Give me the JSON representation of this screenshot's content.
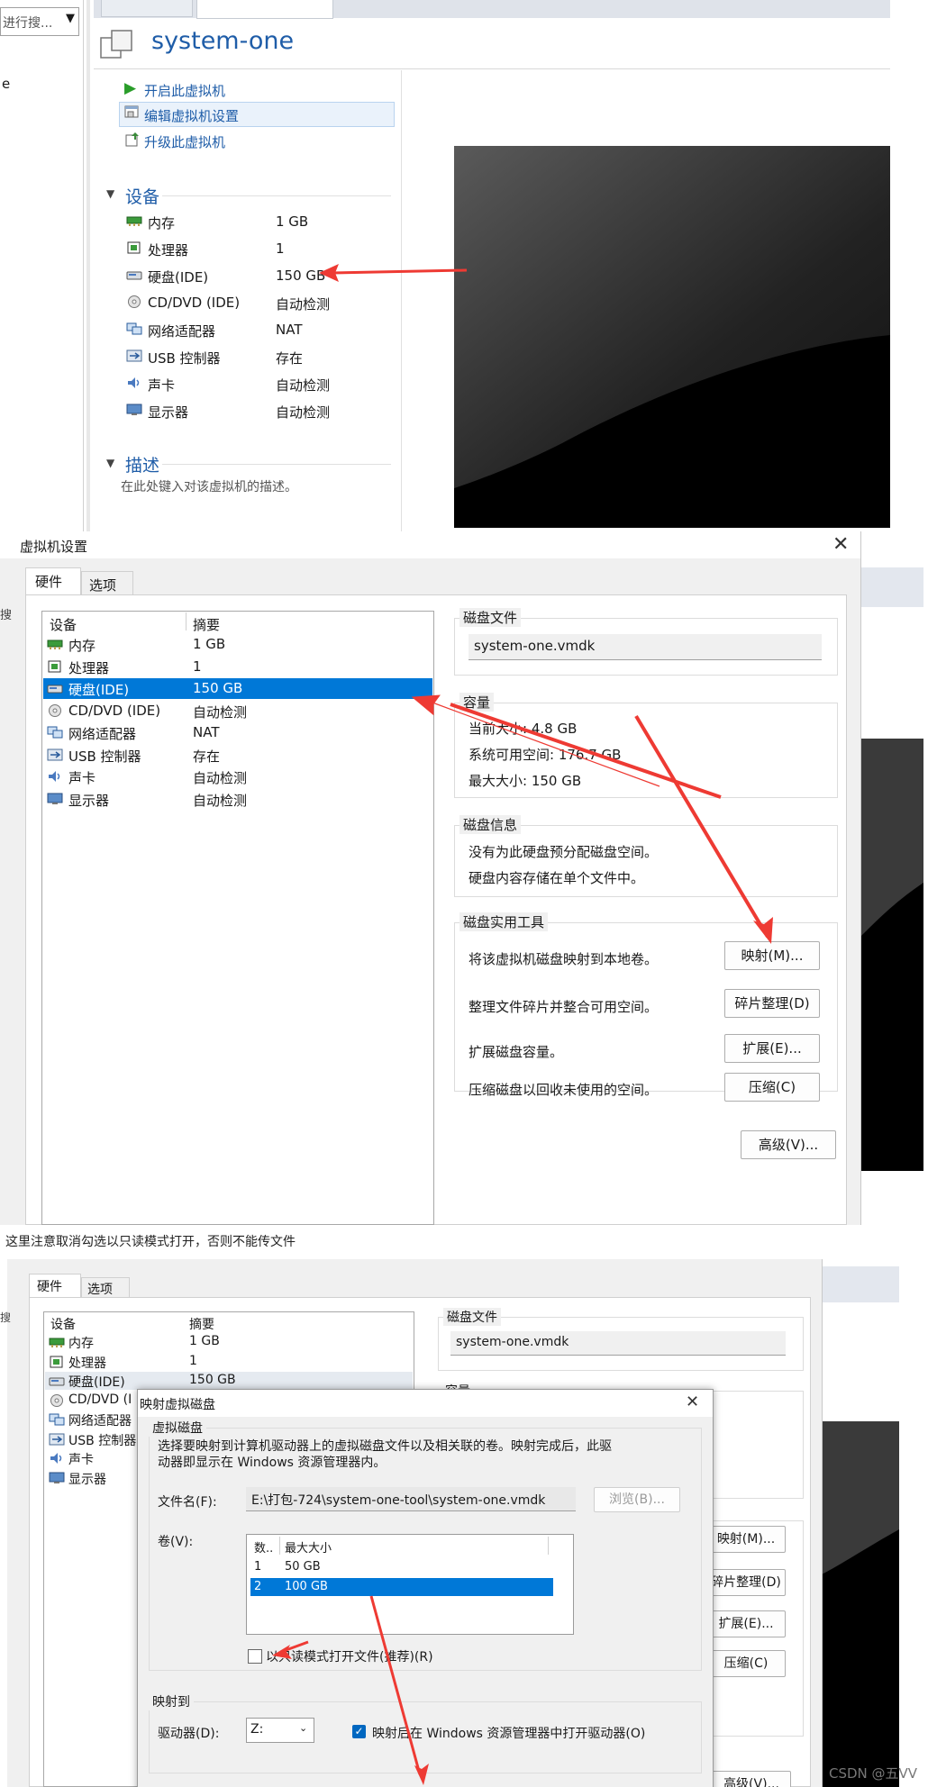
{
  "vm_page": {
    "search_placeholder": "进行搜...",
    "tab_partial": "e",
    "title": "system-one",
    "actions": [
      "开启此虚拟机",
      "编辑虚拟机设置",
      "升级此虚拟机"
    ],
    "devices_header": "设备",
    "devices": [
      {
        "name": "内存",
        "value": "1 GB"
      },
      {
        "name": "处理器",
        "value": "1"
      },
      {
        "name": "硬盘(IDE)",
        "value": "150 GB"
      },
      {
        "name": "CD/DVD (IDE)",
        "value": "自动检测"
      },
      {
        "name": "网络适配器",
        "value": "NAT"
      },
      {
        "name": "USB 控制器",
        "value": "存在"
      },
      {
        "name": "声卡",
        "value": "自动检测"
      },
      {
        "name": "显示器",
        "value": "自动检测"
      }
    ],
    "desc_header": "描述",
    "desc_text": "在此处键入对该虚拟机的描述。"
  },
  "settings": {
    "title": "虚拟机设置",
    "tabs": [
      "硬件",
      "选项"
    ],
    "left_partial": "搜",
    "col_device": "设备",
    "col_summary": "摘要",
    "devices": [
      {
        "name": "内存",
        "value": "1 GB"
      },
      {
        "name": "处理器",
        "value": "1"
      },
      {
        "name": "硬盘(IDE)",
        "value": "150 GB"
      },
      {
        "name": "CD/DVD (IDE)",
        "value": "自动检测"
      },
      {
        "name": "网络适配器",
        "value": "NAT"
      },
      {
        "name": "USB 控制器",
        "value": "存在"
      },
      {
        "name": "声卡",
        "value": "自动检测"
      },
      {
        "name": "显示器",
        "value": "自动检测"
      }
    ],
    "disk_file_title": "磁盘文件",
    "disk_file": "system-one.vmdk",
    "capacity_title": "容量",
    "current_size": "当前大小: 4.8 GB",
    "free_space": "系统可用空间: 176.7 GB",
    "max_size": "最大大小: 150 GB",
    "disk_info_title": "磁盘信息",
    "disk_info_1": "没有为此硬盘预分配磁盘空间。",
    "disk_info_2": "硬盘内容存储在单个文件中。",
    "tools_title": "磁盘实用工具",
    "tool_map_text": "将该虚拟机磁盘映射到本地卷。",
    "tool_map_btn": "映射(M)...",
    "tool_defrag_text": "整理文件碎片并整合可用空间。",
    "tool_defrag_btn": "碎片整理(D)",
    "tool_expand_text": "扩展磁盘容量。",
    "tool_expand_btn": "扩展(E)...",
    "tool_compact_text": "压缩磁盘以回收未使用的空间。",
    "tool_compact_btn": "压缩(C)",
    "advanced_btn": "高级(V)..."
  },
  "note": "这里注意取消勾选以只读模式打开，否则不能传文件",
  "third": {
    "tabs": [
      "硬件",
      "选项"
    ],
    "left_partial": "搜",
    "col_device": "设备",
    "col_summary": "摘要",
    "devices": [
      {
        "name": "内存",
        "value": "1 GB"
      },
      {
        "name": "处理器",
        "value": "1"
      },
      {
        "name": "硬盘(IDE)",
        "value": "150 GB"
      },
      {
        "name": "CD/DVD (I",
        "value": ""
      },
      {
        "name": "网络适配器",
        "value": ""
      },
      {
        "name": "USB 控制器",
        "value": ""
      },
      {
        "name": "声卡",
        "value": ""
      },
      {
        "name": "显示器",
        "value": ""
      }
    ],
    "disk_file_title": "磁盘文件",
    "disk_file": "system-one.vmdk",
    "capacity_partial": "容量",
    "map_btn": "映射(M)...",
    "defrag_btn": "碎片整理(D)",
    "expand_btn": "扩展(E)...",
    "compact_btn": "压缩(C)",
    "advanced_btn": "高级(V)..."
  },
  "map_dialog": {
    "title": "映射虚拟磁盘",
    "group_title": "虚拟磁盘",
    "desc_line1": "选择要映射到计算机驱动器上的虚拟磁盘文件以及相关联的卷。映射完成后，此驱",
    "desc_line2": "动器即显示在 Windows 资源管理器内。",
    "filename_label": "文件名(F):",
    "filename_value": "E:\\打包-724\\system-one-tool\\system-one.vmdk",
    "browse_btn": "浏览(B)...",
    "volume_label": "卷(V):",
    "vol_col_num": "数..",
    "vol_col_size": "最大大小",
    "volumes": [
      {
        "num": "1",
        "size": "50 GB",
        "selected": false
      },
      {
        "num": "2",
        "size": "100 GB",
        "selected": true
      }
    ],
    "readonly_label": "以只读模式打开文件(推荐)(R)",
    "readonly_checked": false,
    "map_to_title": "映射到",
    "drive_label": "驱动器(D):",
    "drive_value": "Z:",
    "open_explorer_label": "映射后在 Windows 资源管理器中打开驱动器(O)",
    "open_explorer_checked": true
  },
  "watermark": "CSDN @五VV",
  "colors": {
    "accent": "#0078d7",
    "arrow": "#ee3a33",
    "title_blue": "#1f5da8"
  }
}
